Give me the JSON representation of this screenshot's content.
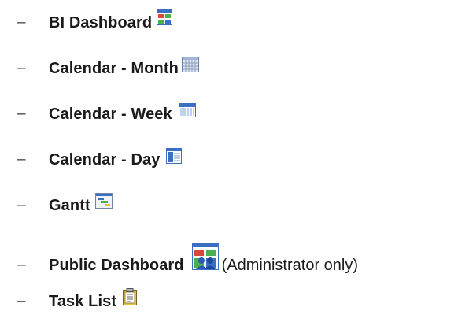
{
  "list": {
    "bullet": "–",
    "items": [
      {
        "label": "BI Dashboard",
        "icon": "bi-dashboard-icon",
        "note": ""
      },
      {
        "label": "Calendar - Month",
        "icon": "calendar-month-icon",
        "note": ""
      },
      {
        "label": "Calendar - Week",
        "icon": "calendar-week-icon",
        "note": ""
      },
      {
        "label": "Calendar - Day",
        "icon": "calendar-day-icon",
        "note": ""
      },
      {
        "label": "Gantt",
        "icon": "gantt-icon",
        "note": ""
      },
      {
        "label": "Public Dashboard",
        "icon": "public-dashboard-icon",
        "note": "(Administrator only)"
      },
      {
        "label": "Task List",
        "icon": "task-list-icon",
        "note": ""
      }
    ]
  },
  "colors": {
    "icon_blue": "#3a6fc4",
    "icon_light_blue": "#bcd3f2",
    "icon_red": "#d9473a",
    "icon_green": "#4caf50",
    "icon_yellow": "#e7c33a"
  }
}
